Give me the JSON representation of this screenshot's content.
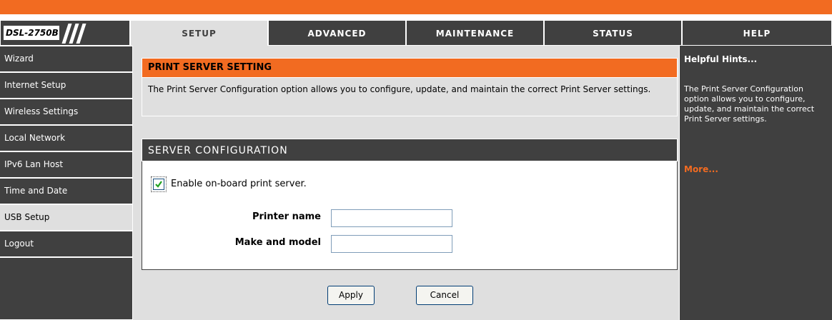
{
  "brand": {
    "model": "DSL-2750B"
  },
  "tabs": [
    {
      "label": "SETUP"
    },
    {
      "label": "ADVANCED"
    },
    {
      "label": "MAINTENANCE"
    },
    {
      "label": "STATUS"
    },
    {
      "label": "HELP"
    }
  ],
  "nav": {
    "items": [
      {
        "label": "Wizard"
      },
      {
        "label": "Internet Setup"
      },
      {
        "label": "Wireless Settings"
      },
      {
        "label": "Local Network"
      },
      {
        "label": "IPv6 Lan Host"
      },
      {
        "label": "Time and Date"
      },
      {
        "label": "USB Setup"
      },
      {
        "label": "Logout"
      }
    ],
    "active": "USB Setup"
  },
  "print_server": {
    "title": "PRINT SERVER SETTING",
    "description": "The Print Server Configuration option allows you to configure, update, and maintain the correct Print Server settings."
  },
  "server_config": {
    "title": "SERVER CONFIGURATION",
    "enable_label": "Enable on-board print server.",
    "enable_checked": true,
    "printer_name_label": "Printer name",
    "printer_name_value": "",
    "make_model_label": "Make and model",
    "make_model_value": ""
  },
  "actions": {
    "apply_label": "Apply",
    "cancel_label": "Cancel"
  },
  "help": {
    "title": "Helpful Hints...",
    "text": "The Print Server Configuration option allows you to configure, update, and maintain the correct Print Server settings.",
    "more": "More..."
  },
  "colors": {
    "accent": "#f26b21",
    "dark": "#404040",
    "panel": "#dfdfdf"
  }
}
